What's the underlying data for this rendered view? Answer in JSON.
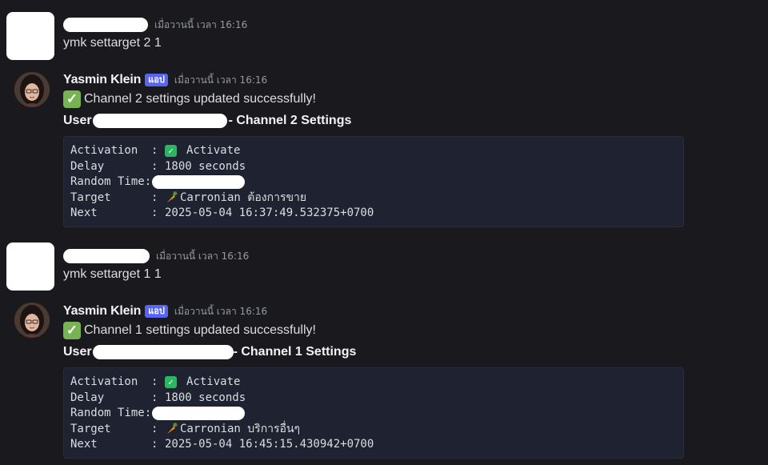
{
  "messages": [
    {
      "type": "user",
      "timestamp": "เมื่อวานนี้ เวลา 16:16",
      "text": "ymk settarget 2 1"
    },
    {
      "type": "bot",
      "author": "Yasmin Klein",
      "badge": "แอป",
      "timestamp": "เมื่อวานนี้ เวลา 16:16",
      "status_text": "Channel 2 settings updated successfully!",
      "heading_prefix": "User",
      "heading_suffix": "- Channel 2 Settings",
      "rows": [
        {
          "key": "Activation",
          "sep": ":",
          "value": "Activate",
          "icon": "check-icon"
        },
        {
          "key": "Delay",
          "sep": ":",
          "value": "1800 seconds"
        },
        {
          "key": "Random Time:",
          "sep": "",
          "value": "",
          "redacted": true
        },
        {
          "key": "Target",
          "sep": ":",
          "value": "Carronian ต้องการขาย",
          "icon": "carrot-icon"
        },
        {
          "key": "Next",
          "sep": ":",
          "value": "2025-05-04 16:37:49.532375+0700"
        }
      ]
    },
    {
      "type": "user",
      "timestamp": "เมื่อวานนี้ เวลา 16:16",
      "text": "ymk settarget 1 1"
    },
    {
      "type": "bot",
      "author": "Yasmin Klein",
      "badge": "แอป",
      "timestamp": "เมื่อวานนี้ เวลา 16:16",
      "status_text": "Channel 1 settings updated successfully!",
      "heading_prefix": "User",
      "heading_suffix": "- Channel 1 Settings",
      "rows": [
        {
          "key": "Activation",
          "sep": ":",
          "value": "Activate",
          "icon": "check-icon"
        },
        {
          "key": "Delay",
          "sep": ":",
          "value": "1800 seconds"
        },
        {
          "key": "Random Time:",
          "sep": "",
          "value": "",
          "redacted": true
        },
        {
          "key": "Target",
          "sep": ":",
          "value": "Carronian บริการอื่นๆ",
          "icon": "carrot-icon"
        },
        {
          "key": "Next",
          "sep": ":",
          "value": "2025-05-04 16:45:15.430942+0700"
        }
      ]
    }
  ],
  "colors": {
    "background": "#1a1a1e",
    "badge": "#5865f2",
    "codeblock": "#1f2231",
    "check": "#77b255"
  }
}
